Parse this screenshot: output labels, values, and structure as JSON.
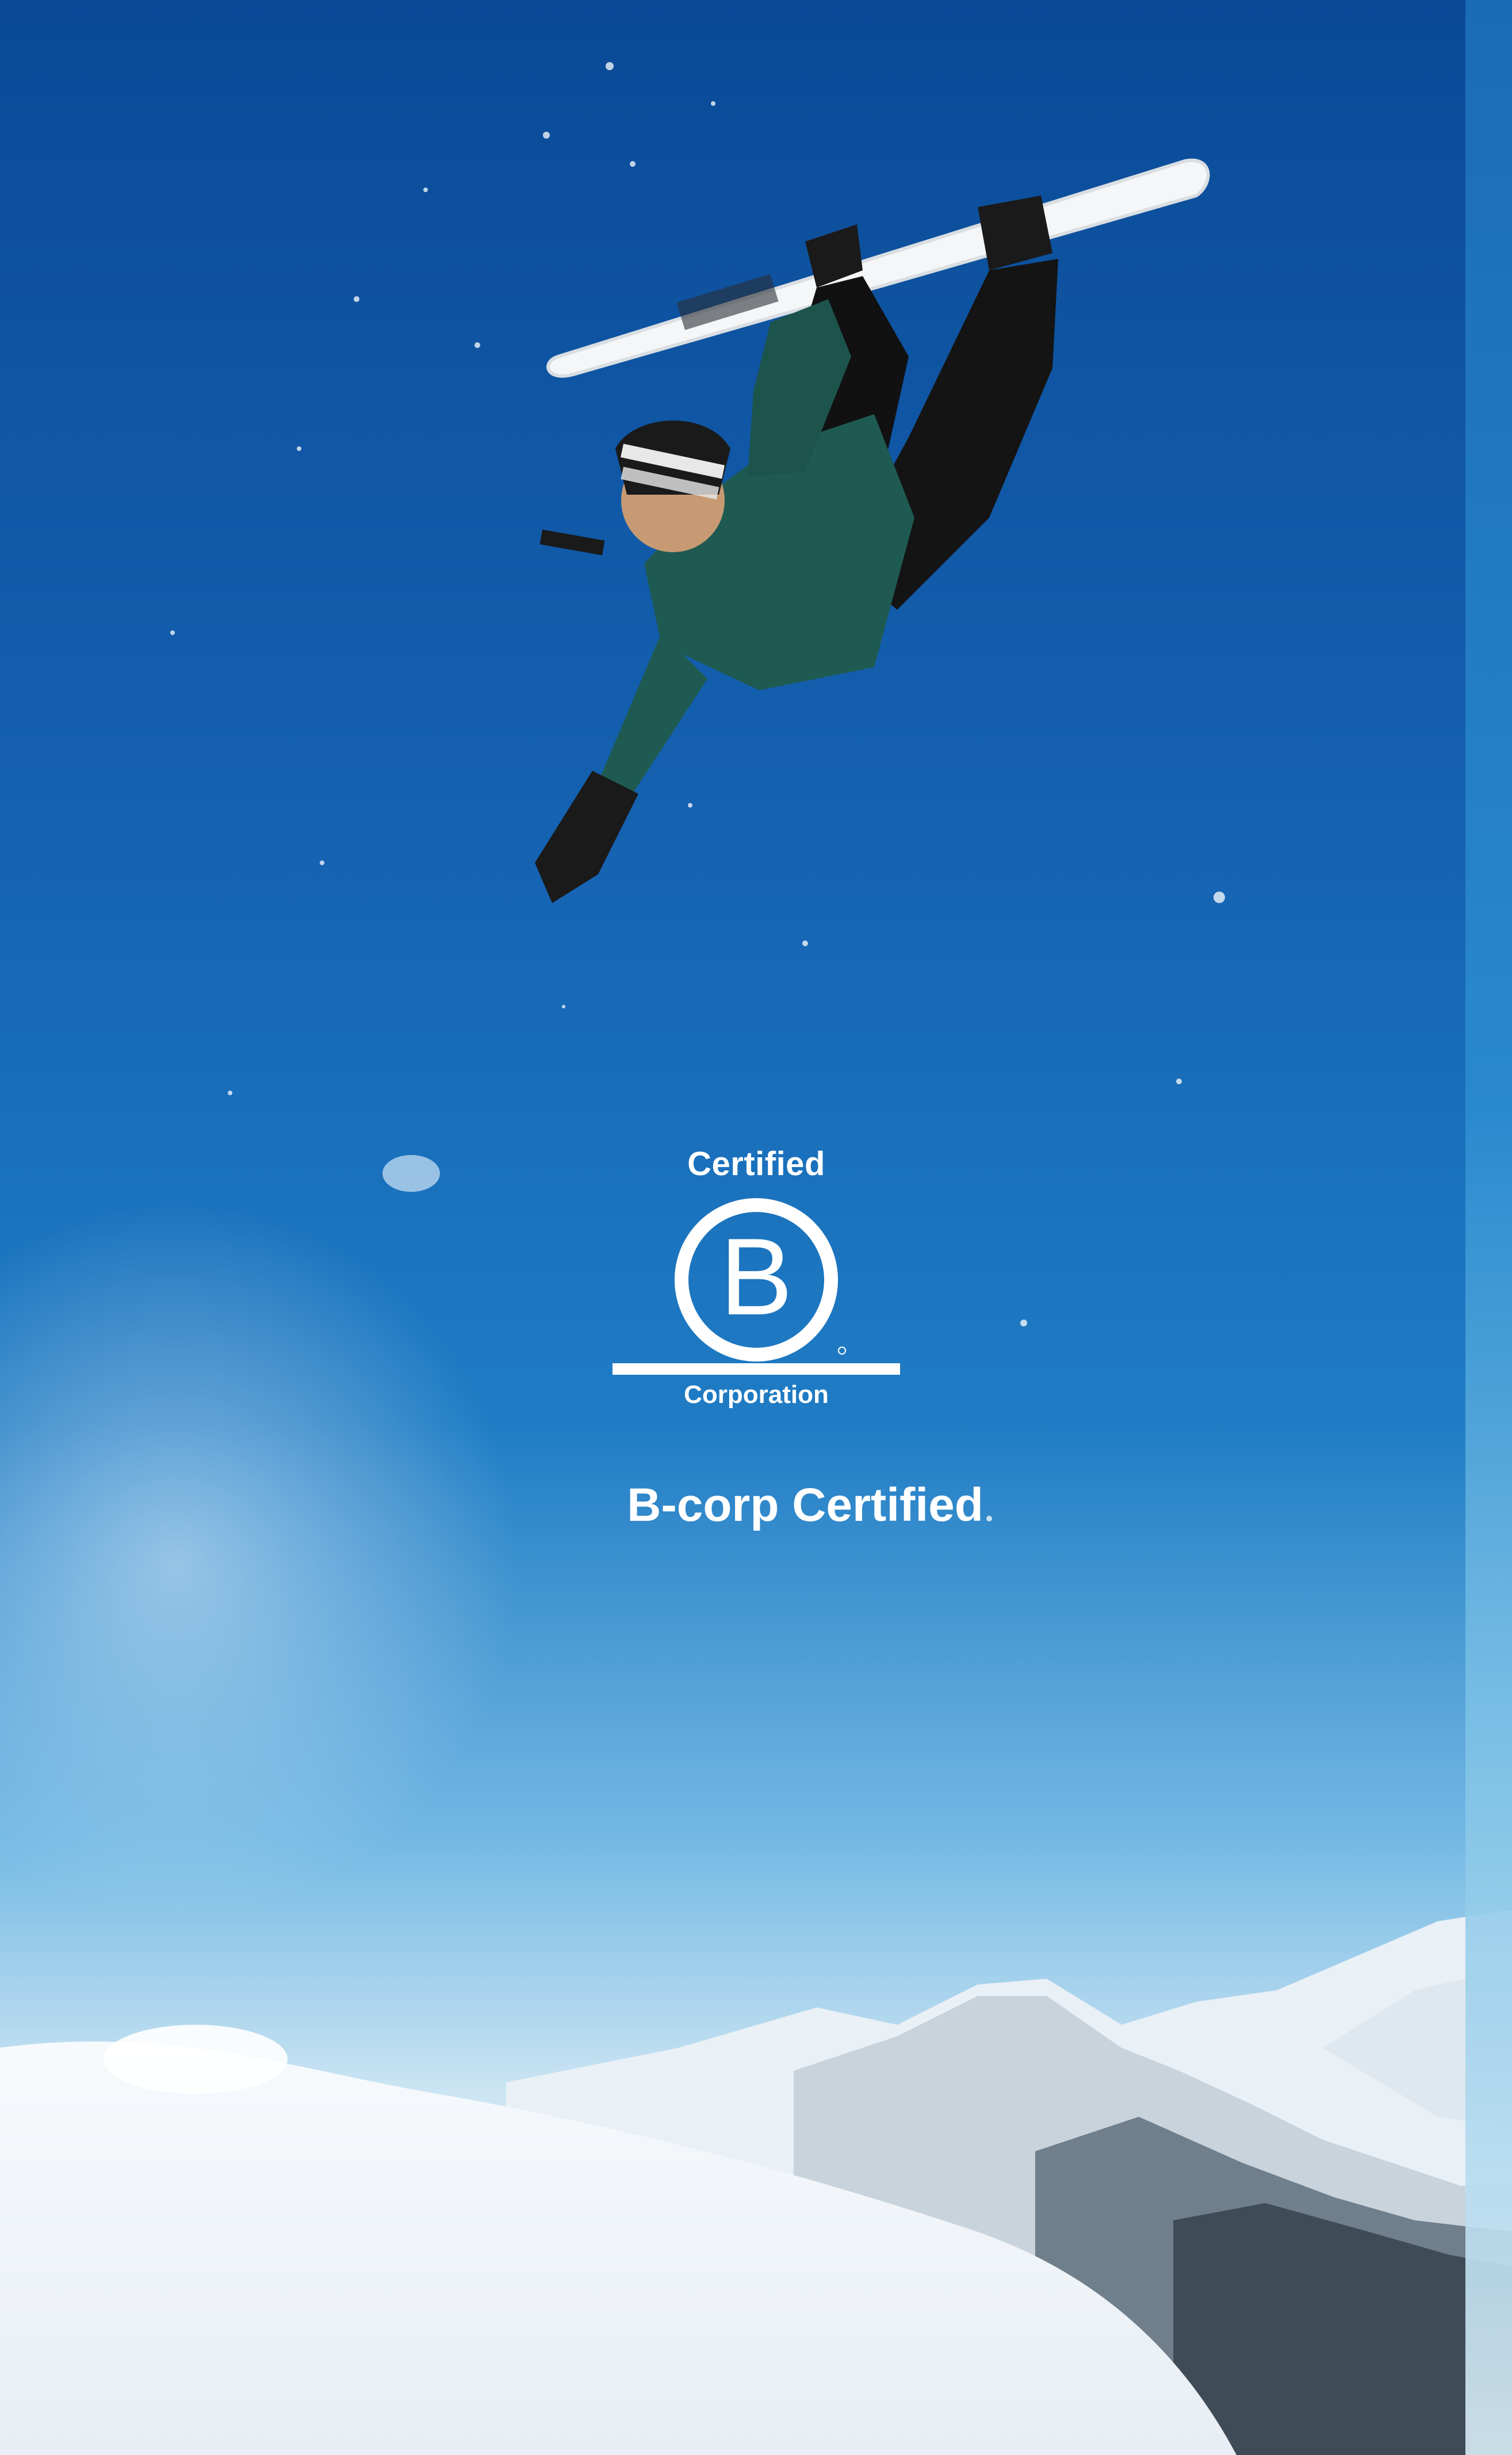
{
  "badge": {
    "top_text": "Certified",
    "letter": "B",
    "bottom_text": "Corporation"
  },
  "caption": {
    "text": "B-corp Certified"
  },
  "scene": {
    "subject": "snowboarder-mid-air",
    "colors": {
      "sky_top": "#0d4f9c",
      "sky_mid": "#1f79c2",
      "sky_low": "#8ec7ea",
      "snow": "#f3f7fb",
      "jacket": "#1e5a52",
      "pants": "#121212",
      "board": "#f4f6f7"
    }
  }
}
